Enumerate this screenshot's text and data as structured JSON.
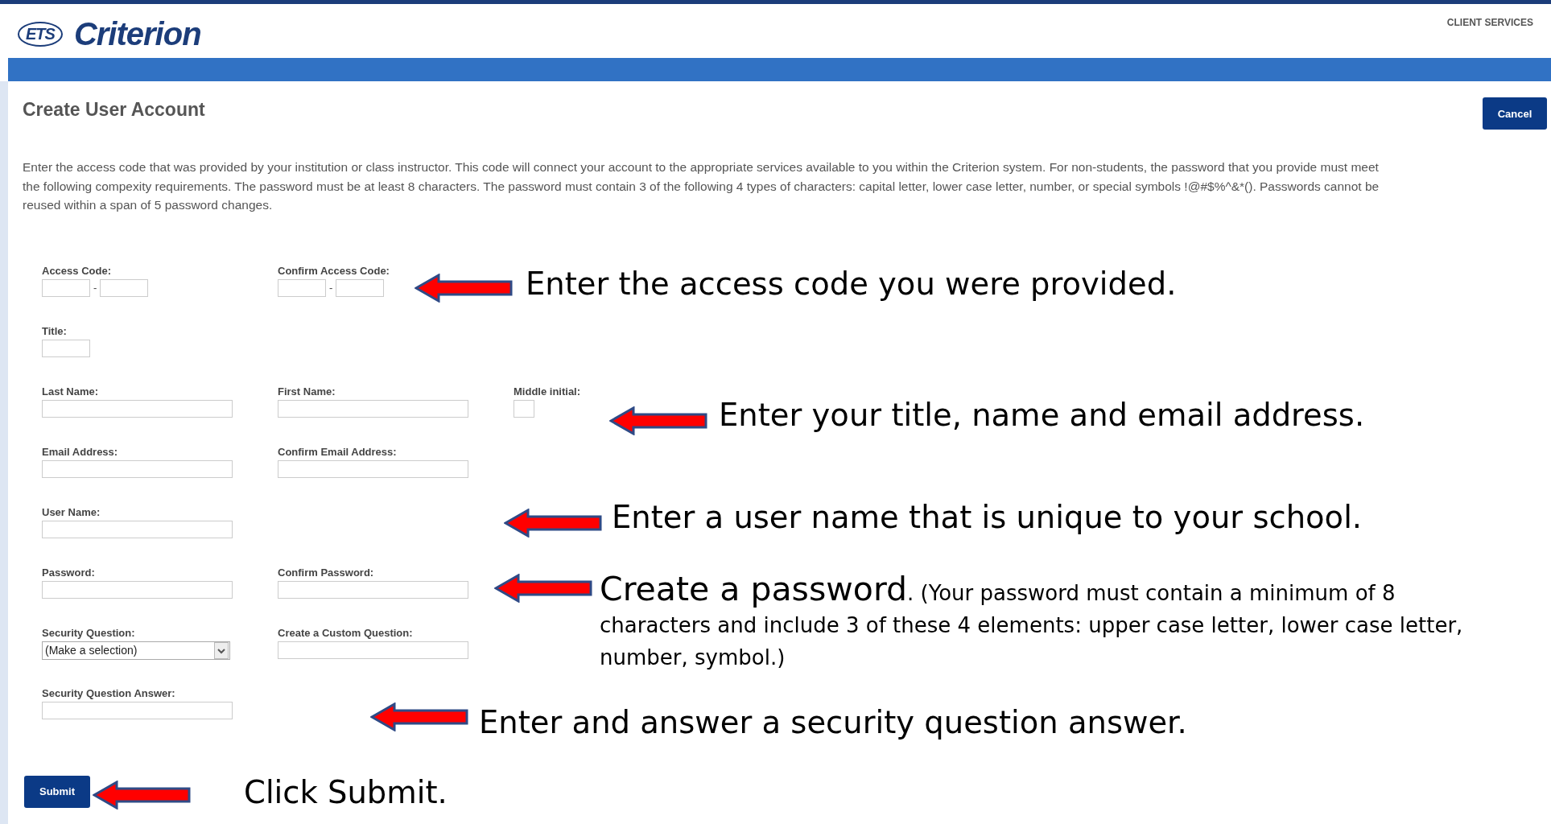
{
  "header": {
    "logo": {
      "badge": "ETS",
      "name": "Criterion"
    },
    "link": "CLIENT SERVICES"
  },
  "page": {
    "title": "Create User Account",
    "cancel": "Cancel",
    "description": "Enter the access code that was provided by your institution or class instructor. This code will connect your account to the appropriate services available to you within the Criterion system. For non-students, the password that you provide must meet the following compexity requirements. The password must be at least 8 characters. The password must contain 3 of the following 4 types of characters: capital letter, lower case letter, number, or special symbols !@#$%^&*(). Passwords cannot be reused within a span of 5 password changes."
  },
  "form": {
    "rows": [
      [
        {
          "label": "Access Code:",
          "kind": "split",
          "separator": "-"
        },
        {
          "label": "Confirm Access Code:",
          "kind": "split",
          "separator": "-"
        }
      ],
      [
        {
          "label": "Title:",
          "kind": "short"
        }
      ],
      [
        {
          "label": "Last Name:",
          "kind": "text"
        },
        {
          "label": "First Name:",
          "kind": "text"
        },
        {
          "label": "Middle initial:",
          "kind": "tiny"
        }
      ],
      [
        {
          "label": "Email Address:",
          "kind": "text"
        },
        {
          "label": "Confirm Email Address:",
          "kind": "text"
        }
      ],
      [
        {
          "label": "User Name:",
          "kind": "text"
        }
      ],
      [
        {
          "label": "Password:",
          "kind": "text"
        },
        {
          "label": "Confirm Password:",
          "kind": "text"
        }
      ],
      [
        {
          "label": "Security Question:",
          "kind": "select",
          "value": "(Make a selection)"
        },
        {
          "label": "Create a Custom Question:",
          "kind": "text"
        }
      ],
      [
        {
          "label": "Security Question Answer:",
          "kind": "text"
        }
      ]
    ],
    "submit": "Submit"
  },
  "annotations": [
    {
      "text": "Enter the access code you were provided."
    },
    {
      "text": "Enter your title, name and email address."
    },
    {
      "text": "Enter a user name that is unique to your school."
    },
    {
      "text": "Create a password",
      "note": ". (Your password must contain a minimum of 8 characters and include 3 of these 4 elements:  upper case letter, lower case letter, number, symbol.)"
    },
    {
      "text": "Enter and answer a security question answer."
    },
    {
      "text": "Click Submit."
    }
  ]
}
